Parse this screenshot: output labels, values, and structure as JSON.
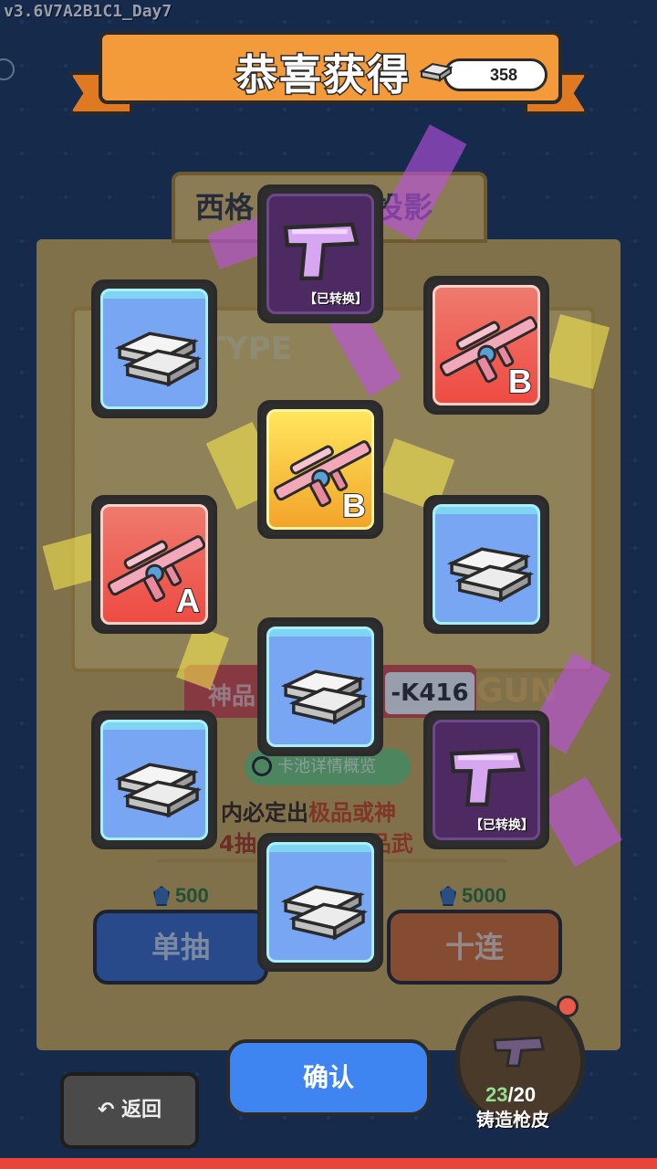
{
  "version": "v3.6V7A2B1C1_Day7",
  "banner": {
    "title": "恭喜获得",
    "currency_value": "358",
    "currency_icon": "silver-bar-icon"
  },
  "pool": {
    "title": "西格",
    "title_tail": "投影",
    "type_watermark": "TYPE",
    "gun_watermark": "GUN",
    "quality_label": "神品",
    "quality_name": "-K416",
    "detail_label": "卡池详情概览",
    "rule_line1": "内必定出",
    "rule_line1_hl": "极品或神",
    "rule_line2": "4抽",
    "rule_line2_hl": "品武"
  },
  "draw": {
    "single_label": "单抽",
    "single_cost": "500",
    "ten_label": "十连",
    "ten_cost": "5000",
    "gem_icon": "gem-icon"
  },
  "cards": [
    {
      "kind": "silver",
      "rarity": "blue",
      "icon": "silver-bar-icon"
    },
    {
      "kind": "pistol",
      "rarity": "purple",
      "icon": "pistol-icon",
      "note": "【已转换】"
    },
    {
      "kind": "sniper-rifle",
      "rarity": "red",
      "icon": "sniper-rifle-icon",
      "grade": "B"
    },
    {
      "kind": "sniper-rifle",
      "rarity": "gold",
      "icon": "sniper-rifle-icon",
      "grade": "B"
    },
    {
      "kind": "sniper-rifle",
      "rarity": "red",
      "icon": "sniper-rifle-icon",
      "grade": "A"
    },
    {
      "kind": "silver",
      "rarity": "blue",
      "icon": "silver-bar-icon"
    },
    {
      "kind": "silver",
      "rarity": "blue",
      "icon": "silver-bar-icon"
    },
    {
      "kind": "silver",
      "rarity": "blue",
      "icon": "silver-bar-icon"
    },
    {
      "kind": "pistol",
      "rarity": "purple",
      "icon": "pistol-icon",
      "note": "【已转换】"
    },
    {
      "kind": "silver",
      "rarity": "blue",
      "icon": "silver-bar-icon"
    }
  ],
  "confirm_label": "确认",
  "back_label": "返回",
  "back_icon": "undo-arrow-icon",
  "forge": {
    "current": "23",
    "total": "/20",
    "label": "铸造枪皮"
  }
}
